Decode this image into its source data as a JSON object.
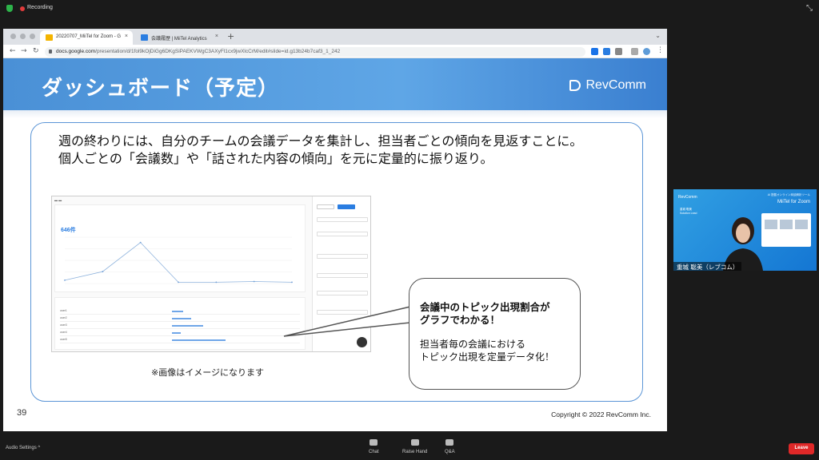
{
  "top_bar": {
    "recording_label": "Recording"
  },
  "browser": {
    "tabs": [
      {
        "title": "20220707_MiiTel for Zoom - G",
        "active": true,
        "favicon_color": "#f4b400"
      },
      {
        "title": "会議履歴 | MiiTel Analytics",
        "active": false,
        "favicon_color": "#2a7de1"
      }
    ],
    "close_glyph": "×",
    "new_tab_glyph": "+",
    "address": {
      "host": "docs.google.com",
      "path": "/presentation/d/1fol9kOjDiGg6DKgSiPAEKVWgC3AXyFl1cx9jwXlcCrM/edit#slide=id.g13b24b7caf3_1_242"
    }
  },
  "slide": {
    "title": "ダッシュボード（予定）",
    "brand": "RevComm",
    "lead_line1": "週の終わりには、自分のチームの会議データを集計し、担当者ごとの傾向を見返すことに。",
    "lead_line2": "個人ごとの「会議数」や「話された内容の傾向」を元に定量的に振り返り。",
    "caption": "※画像はイメージになります",
    "bubble_heading_line1": "会議中のトピック出現割合が",
    "bubble_heading_line2": "グラフでわかる！",
    "bubble_body_line1": "担当者毎の会議における",
    "bubble_body_line2": "トピック出現を定量データ化！",
    "page_number": "39",
    "copyright": "Copyright © 2022 RevComm Inc.",
    "screenshot": {
      "total_value": "646",
      "total_unit": "件",
      "table_rows": [
        {
          "name": "user1",
          "bar": 0.1
        },
        {
          "name": "user2",
          "bar": 0.17
        },
        {
          "name": "user3",
          "bar": 0.28
        },
        {
          "name": "user4",
          "bar": 0.08
        },
        {
          "name": "user5",
          "bar": 0.48
        }
      ],
      "line_chart": {
        "values": [
          5,
          18,
          62,
          2,
          2,
          3,
          2
        ]
      }
    }
  },
  "participant": {
    "name": "重城 聡美（レブコム）",
    "tile_brand": "RevComm",
    "tile_subtitle": "AI 搭載オンライン商談解析ツール",
    "tile_product": "MiiTel for Zoom",
    "tile_person_name": "重城 聡美",
    "tile_person_title": "Solution Lead"
  },
  "zoom_controls": {
    "audio_settings": "Audio Settings",
    "chat": "Chat",
    "raise_hand": "Raise Hand",
    "qa": "Q&A",
    "leave": "Leave"
  }
}
